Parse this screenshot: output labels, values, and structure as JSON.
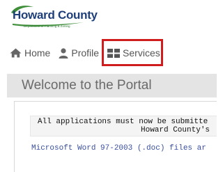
{
  "logo": {
    "title": "Howard County",
    "subtitle": "Department of Planning & Zoning"
  },
  "nav": {
    "items": [
      {
        "label": "Home",
        "icon": "home-icon"
      },
      {
        "label": "Profile",
        "icon": "user-icon"
      },
      {
        "label": "Services",
        "icon": "grid-icon"
      }
    ]
  },
  "highlight_color": "#d01c1c",
  "main": {
    "title": "Welcome to the Portal",
    "notice_line1": "All applications must now be submitte",
    "notice_line2": "Howard County's",
    "doc_note": "Microsoft Word 97-2003 (.doc) files ar"
  }
}
